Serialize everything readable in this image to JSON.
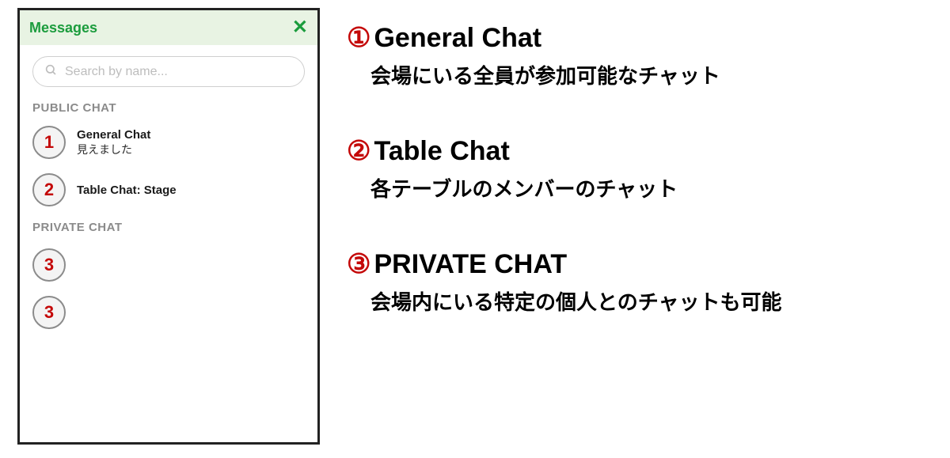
{
  "panel": {
    "title": "Messages",
    "search_placeholder": "Search by name...",
    "sections": {
      "public_label": "PUBLIC CHAT",
      "private_label": "PRIVATE CHAT"
    },
    "public_items": [
      {
        "num": "1",
        "title": "General Chat",
        "preview": "見えました"
      },
      {
        "num": "2",
        "title": "Table Chat: Stage",
        "preview": ""
      }
    ],
    "private_items": [
      {
        "num": "3"
      },
      {
        "num": "3"
      }
    ]
  },
  "annotations": [
    {
      "num": "①",
      "title": "General Chat",
      "desc": "会場にいる全員が参加可能なチャット"
    },
    {
      "num": "②",
      "title": "Table Chat",
      "desc": "各テーブルのメンバーのチャット"
    },
    {
      "num": "③",
      "title": "PRIVATE CHAT",
      "desc": "会場内にいる特定の個人とのチャットも可能"
    }
  ]
}
